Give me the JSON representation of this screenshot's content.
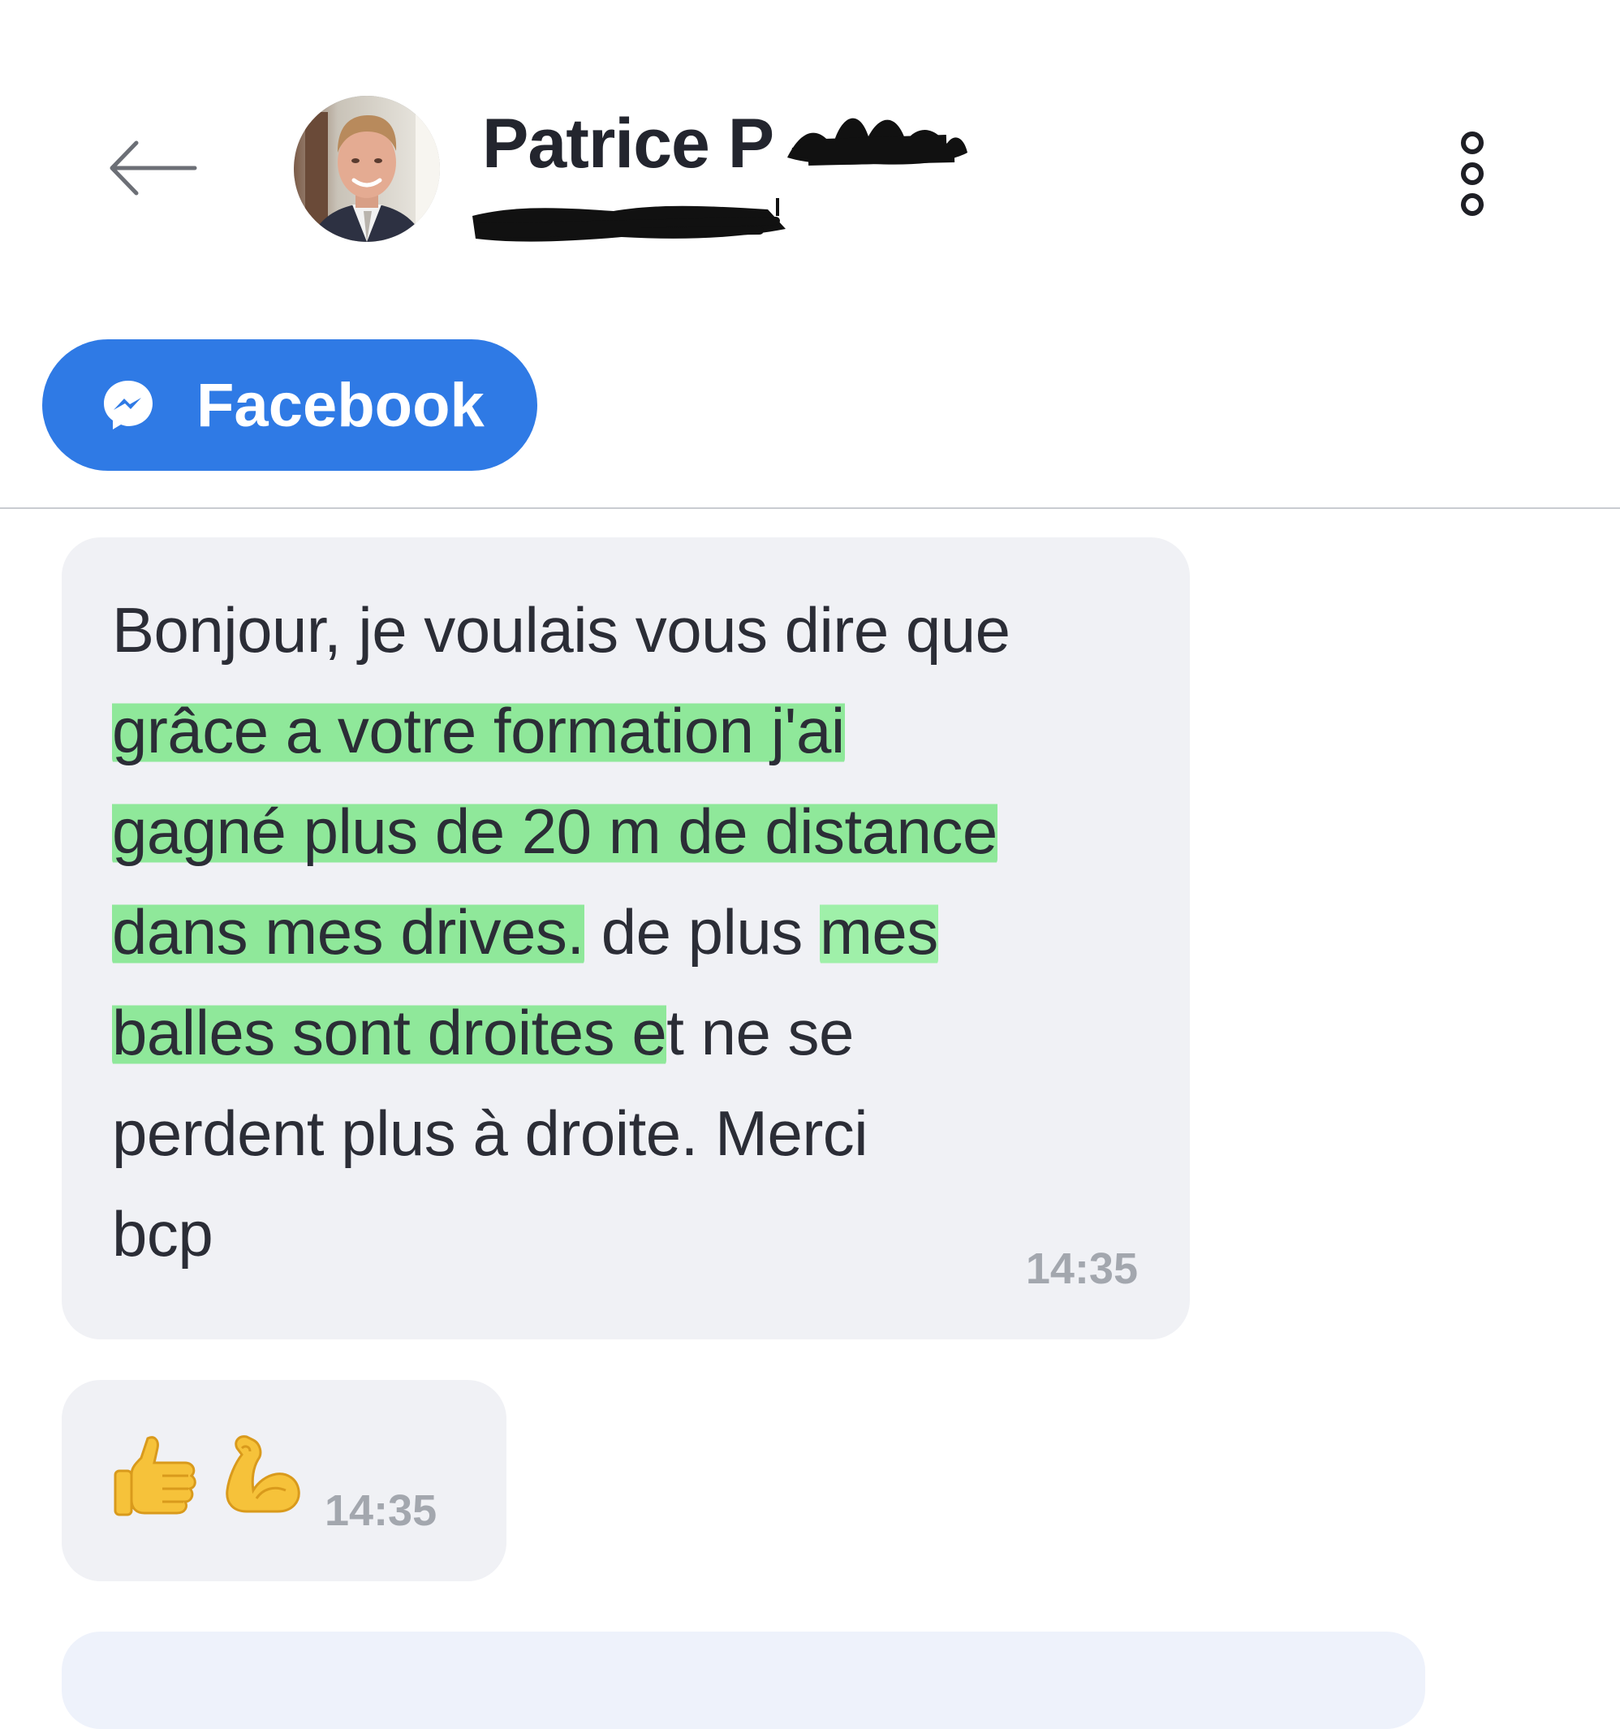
{
  "header": {
    "contact_name": "Patrice P",
    "back_icon": "back-arrow-icon",
    "more_icon": "more-options-icon"
  },
  "channel": {
    "label": "Facebook",
    "icon": "messenger-icon",
    "color": "#2f7ae5"
  },
  "messages": [
    {
      "lines": [
        [
          {
            "text": "Bonjour, je voulais vous dire que"
          }
        ],
        [
          {
            "text": "grâce a votre formation j'ai",
            "highlight": true
          }
        ],
        [
          {
            "text": "gagné plus de 20 m de distance",
            "highlight": true
          }
        ],
        [
          {
            "text": "dans mes drives.",
            "highlight": true
          },
          {
            "text": " de plus "
          },
          {
            "text": "mes",
            "highlight": true
          }
        ],
        [
          {
            "text": "balles sont droites e",
            "highlight": true
          },
          {
            "text": "t ne se"
          }
        ],
        [
          {
            "text": "perdent plus à droite. Merci"
          }
        ],
        [
          {
            "text": "bcp"
          }
        ]
      ],
      "time": "14:35"
    },
    {
      "emojis": [
        "thumbs-up-emoji",
        "flexed-biceps-emoji"
      ],
      "time": "14:35"
    }
  ],
  "colors": {
    "highlight": "#8fe89a",
    "bubble": "#f0f1f5",
    "timestamp": "#a3a7ae"
  }
}
